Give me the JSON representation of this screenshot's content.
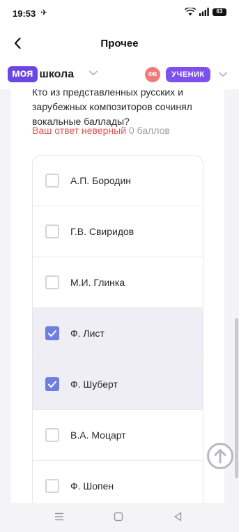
{
  "status_bar": {
    "time": "19:53",
    "battery": "63",
    "icons": [
      "airplane-icon",
      "wifi-icon",
      "signal-icon",
      "battery-icon"
    ]
  },
  "header": {
    "title": "Прочее",
    "back_icon": "chevron-left-icon"
  },
  "brand": {
    "logo_badge": "моя",
    "logo_text": "школа",
    "avatar_initials": "ФВ",
    "role": "УЧЕНИК",
    "accent_color": "#6b46e5"
  },
  "question": {
    "text": "Кто из представленных русских и зарубежных композиторов сочинял вокальные баллады?",
    "result_label": "Ваш ответ неверный",
    "points_label": "0 баллов"
  },
  "options": [
    {
      "label": "А.П. Бородин",
      "checked": false
    },
    {
      "label": "Г.В. Свиридов",
      "checked": false
    },
    {
      "label": "М.И. Глинка",
      "checked": false
    },
    {
      "label": "Ф. Лист",
      "checked": true
    },
    {
      "label": "Ф. Шуберт",
      "checked": true
    },
    {
      "label": "В.А. Моцарт",
      "checked": false
    },
    {
      "label": "Ф. Шопен",
      "checked": false
    }
  ],
  "nav_bar": {
    "icons": [
      "menu-icon",
      "home-icon",
      "back-icon"
    ]
  }
}
